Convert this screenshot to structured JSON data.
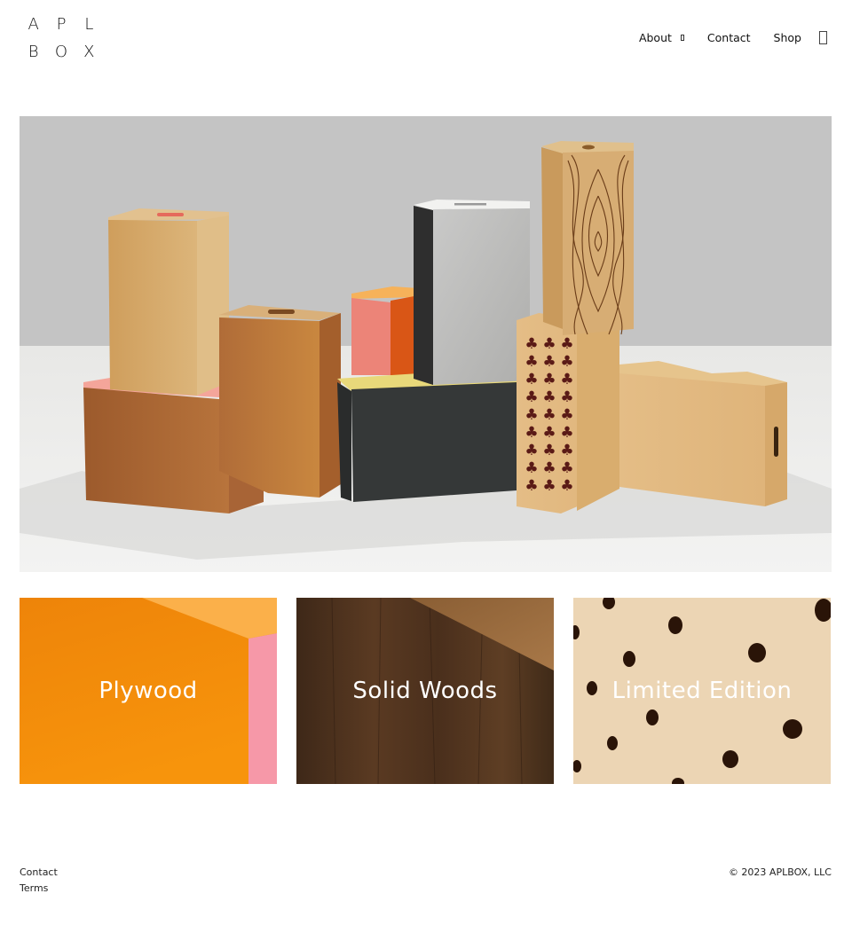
{
  "header": {
    "logo_letters": [
      "A",
      "P",
      "L",
      "B",
      "O",
      "X"
    ],
    "nav": [
      {
        "label": "About",
        "has_dropdown": true,
        "icon": "chevron-down-icon"
      },
      {
        "label": "Contact"
      },
      {
        "label": "Shop"
      }
    ],
    "cart_icon": "cart-icon"
  },
  "hero": {
    "subject": "Apple boxes arrangement"
  },
  "categories": [
    {
      "label": "Plywood",
      "accent": "#f08a0c"
    },
    {
      "label": "Solid Woods",
      "accent": "#4a3020"
    },
    {
      "label": "Limited Edition",
      "accent": "#ecd6b6"
    }
  ],
  "footer": {
    "links": [
      "Contact",
      "Terms"
    ],
    "copyright": "© 2023 APLBOX, LLC"
  }
}
